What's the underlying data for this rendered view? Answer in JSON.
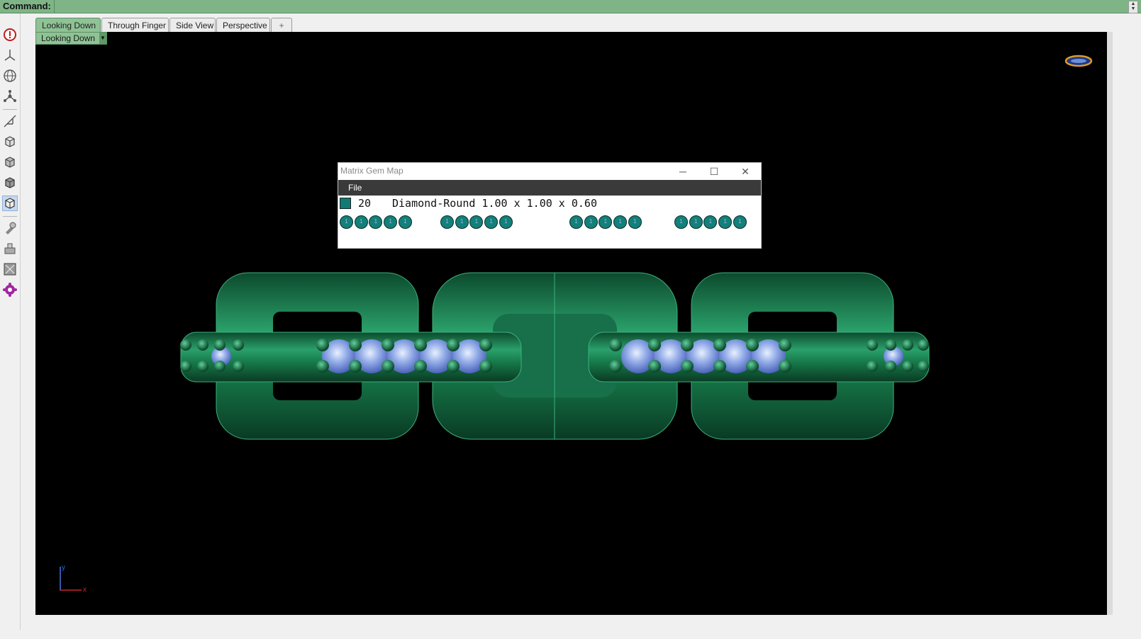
{
  "command": {
    "label": "Command:",
    "value": ""
  },
  "tabs": [
    {
      "label": "Looking Down",
      "active": true
    },
    {
      "label": "Through Finger",
      "active": false
    },
    {
      "label": "Side View",
      "active": false
    },
    {
      "label": "Perspective",
      "active": false
    },
    {
      "label": "+",
      "active": false
    }
  ],
  "viewport": {
    "label": "Looking Down"
  },
  "toolbar": {
    "icons": [
      "info-icon",
      "view-top-icon",
      "globe-icon",
      "axes-icon",
      "scale-icon",
      "cube-wire-icon",
      "cube-shaded-icon",
      "cube-render-icon",
      "cube-active-icon",
      "brush-icon",
      "stamp-icon",
      "image-icon",
      "gear-plugin-icon"
    ]
  },
  "axis": {
    "x": "x",
    "y": "y"
  },
  "gem_map": {
    "title": "Matrix Gem Map",
    "menu": {
      "file": "File"
    },
    "swatch_color": "#127a74",
    "count": "20",
    "description": "Diamond-Round 1.00 x 1.00 x 0.60",
    "gem_label": "1",
    "groups": [
      5,
      5,
      5,
      5
    ]
  },
  "colors": {
    "viewport_bg": "#000000",
    "metal": "#1f8f5a",
    "stones": "#8fa9e6",
    "accent": "#8fc395"
  }
}
